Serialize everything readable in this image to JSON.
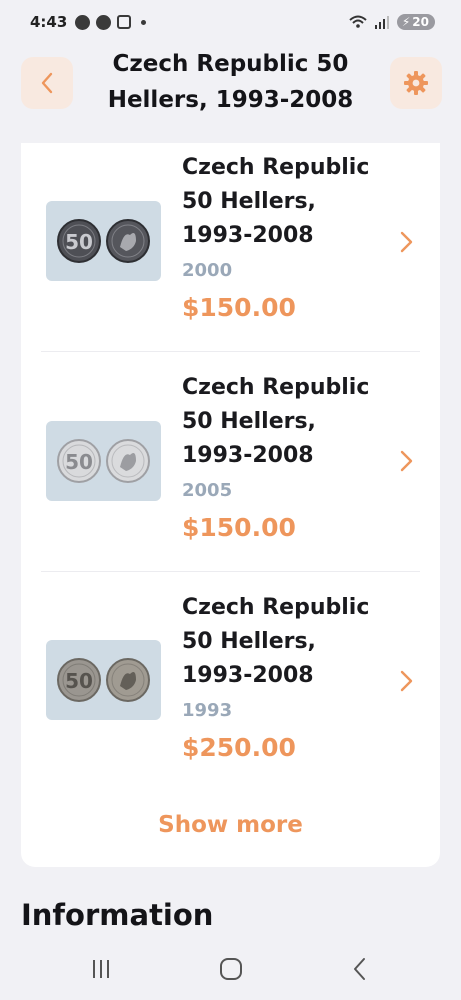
{
  "status_bar": {
    "time": "4:43",
    "battery": "20",
    "icons": [
      "messenger-icon",
      "messenger-icon",
      "screenshot-icon",
      "wifi-icon",
      "signal-icon",
      "battery-icon"
    ]
  },
  "header": {
    "title": "Czech Republic 50 Hellers, 1993-2008",
    "back_icon": "chevron-left-icon",
    "settings_icon": "gear-icon"
  },
  "coins": [
    {
      "name": "Czech Republic 50 Hellers, 1993-2008",
      "year": "2000",
      "price": "$150.00",
      "finish": "dark"
    },
    {
      "name": "Czech Republic 50 Hellers, 1993-2008",
      "year": "2005",
      "price": "$150.00",
      "finish": "bright"
    },
    {
      "name": "Czech Republic 50 Hellers, 1993-2008",
      "year": "1993",
      "price": "$250.00",
      "finish": "worn"
    }
  ],
  "show_more_label": "Show more",
  "information_heading": "Information",
  "colors": {
    "accent": "#ee965c",
    "accent_bg": "#f8e9e0",
    "year_text": "#9aa8b8",
    "thumb_bg": "#cfdbe4",
    "page_bg": "#f1f1f5"
  },
  "nav": {
    "recents_icon": "recents-icon",
    "home_icon": "home-icon",
    "back_icon": "back-icon"
  }
}
